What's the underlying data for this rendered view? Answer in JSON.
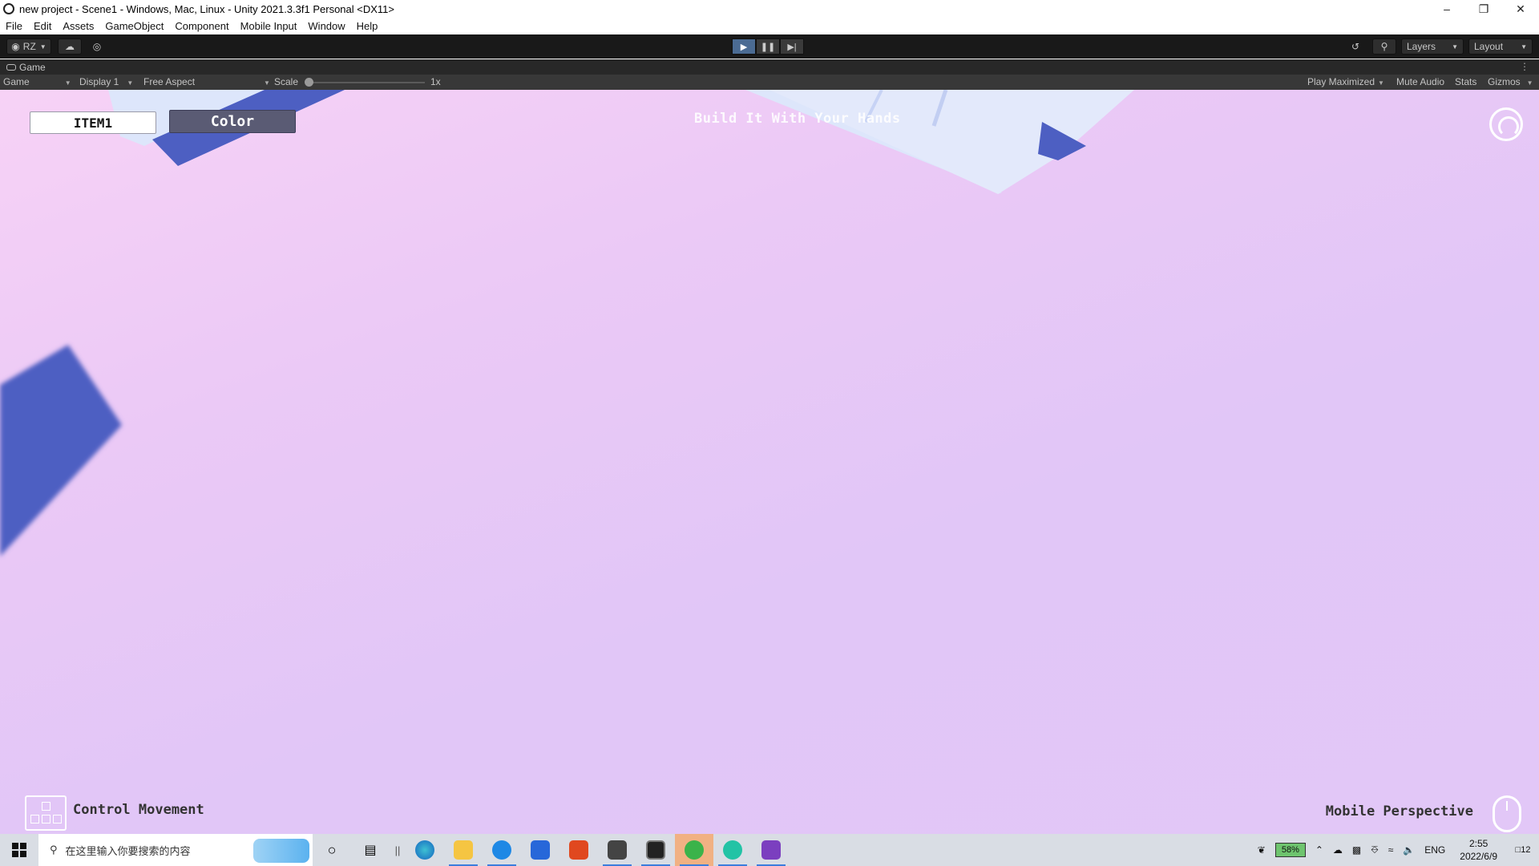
{
  "window": {
    "title": "new project - Scene1 - Windows, Mac, Linux - Unity 2021.3.3f1 Personal <DX11>",
    "controls": [
      "–",
      "❐",
      "✕"
    ]
  },
  "menu": [
    "File",
    "Edit",
    "Assets",
    "GameObject",
    "Component",
    "Mobile Input",
    "Window",
    "Help"
  ],
  "toolbar": {
    "account": "RZ",
    "layers": "Layers",
    "layout": "Layout"
  },
  "game_tab": {
    "label": "Game"
  },
  "game_bar": {
    "view": "Game",
    "display": "Display 1",
    "aspect": "Free Aspect",
    "scale_label": "Scale",
    "scale_value": "1x",
    "play_maximized": "Play Maximized",
    "mute_audio": "Mute Audio",
    "stats": "Stats",
    "gizmos": "Gizmos"
  },
  "game": {
    "item_button": "ITEM1",
    "color_button": "Color",
    "title": "Build It With Your Hands",
    "control_label": "Control Movement",
    "perspective_label": "Mobile Perspective"
  },
  "taskbar": {
    "search_placeholder": "在这里输入你要搜索的内容",
    "battery": "58%",
    "language": "ENG",
    "time": "2:55",
    "date": "2022/6/9",
    "notifications": "12"
  },
  "colors": {
    "play_active": "#4b6b93",
    "viewport_pink": "#f7d2f6",
    "viewport_lilac": "#e1c6f7",
    "block_blue": "#4d5fc2",
    "block_light": "#dde6fb"
  }
}
